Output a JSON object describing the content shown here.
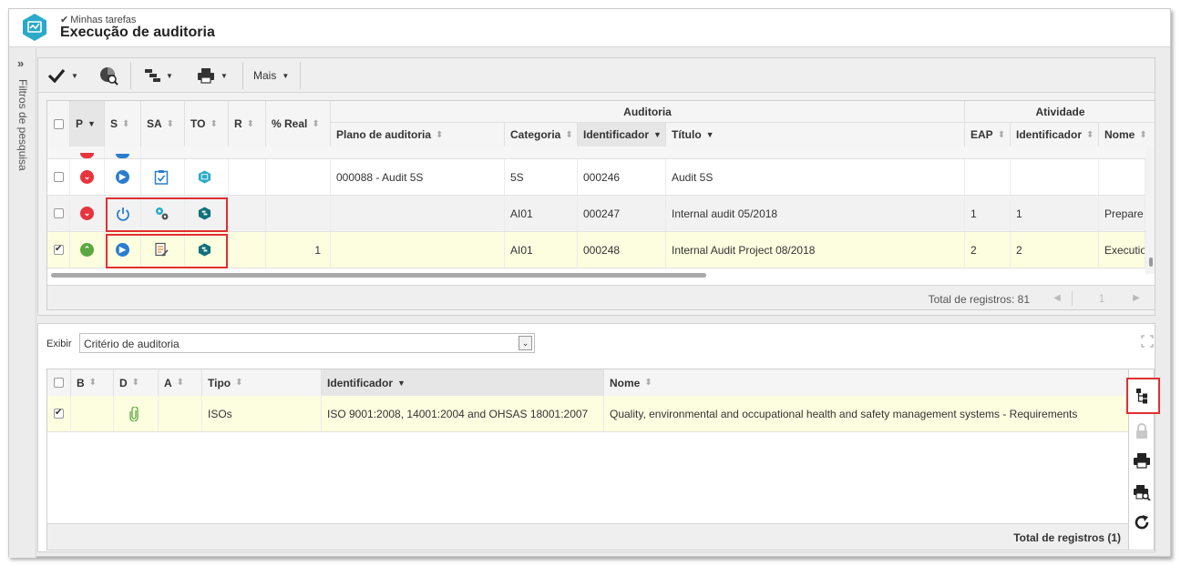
{
  "header": {
    "breadcrumb": "Minhas tarefas",
    "title": "Execução de auditoria"
  },
  "sidebar": {
    "label": "Filtros de pesquisa",
    "toggle": "»"
  },
  "toolbar": {
    "more_label": "Mais"
  },
  "grid1": {
    "group_headers": {
      "auditoria": "Auditoria",
      "atividade": "Atividade"
    },
    "columns": {
      "p": "P",
      "s": "S",
      "sa": "SA",
      "to": "TO",
      "r": "R",
      "real": "% Real",
      "plano": "Plano de auditoria",
      "categoria": "Categoria",
      "identificador": "Identificador",
      "titulo": "Título",
      "eap": "EAP",
      "ativ_identificador": "Identificador",
      "nome": "Nome"
    },
    "rows": [
      {
        "checked": false,
        "p": "down",
        "real": "",
        "plano": "000088 - Audit 5S",
        "categoria": "5S",
        "identificador": "000246",
        "titulo": "Audit 5S",
        "eap": "",
        "ativ_id": "",
        "nome": ""
      },
      {
        "checked": false,
        "p": "down",
        "real": "",
        "plano": "",
        "categoria": "AI01",
        "identificador": "000247",
        "titulo": "Internal audit 05/2018",
        "eap": "1",
        "ativ_id": "1",
        "nome": "Prepare"
      },
      {
        "checked": true,
        "p": "up",
        "real": "1",
        "plano": "",
        "categoria": "AI01",
        "identificador": "000248",
        "titulo": "Internal Audit Project 08/2018",
        "eap": "2",
        "ativ_id": "2",
        "nome": "Executio"
      }
    ],
    "footer": {
      "total": "Total de registros: 81",
      "page": "1"
    }
  },
  "panel2": {
    "exibir_label": "Exibir",
    "exibir_value": "Critério de auditoria",
    "columns": {
      "b": "B",
      "d": "D",
      "a": "A",
      "tipo": "Tipo",
      "identificador": "Identificador",
      "nome": "Nome"
    },
    "rows": [
      {
        "checked": true,
        "tipo": "ISOs",
        "identificador": "ISO 9001:2008, 14001:2004 and OHSAS 18001:2007",
        "nome": "Quality, environmental and occupational health and safety management systems - Requirements"
      }
    ],
    "footer": {
      "total": "Total de registros (1)"
    }
  },
  "colors": {
    "accent": "#2aaac7",
    "selected_row": "#fdfde0",
    "highlight_box": "#e03030"
  }
}
